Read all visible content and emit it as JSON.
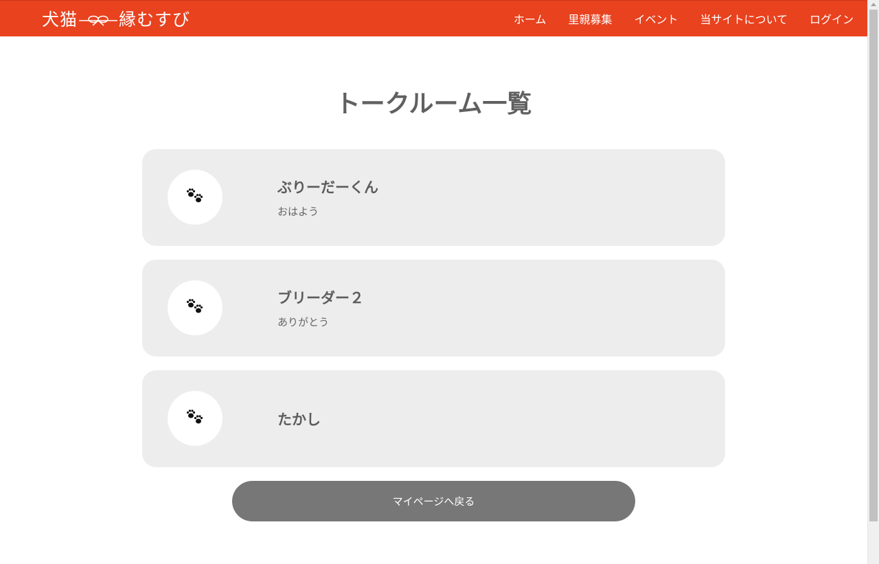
{
  "header": {
    "logo_left": "犬猫",
    "logo_right": "縁むすび",
    "nav": [
      {
        "label": "ホーム"
      },
      {
        "label": "里親募集"
      },
      {
        "label": "イベント"
      },
      {
        "label": "当サイトについて"
      },
      {
        "label": "ログイン"
      }
    ],
    "bg_color": "#e8421f"
  },
  "main": {
    "title": "トークルーム一覧",
    "rooms": [
      {
        "name": "ぶりーだーくん",
        "last_message": "おはよう",
        "icon": "paw-icon"
      },
      {
        "name": "ブリーダー２",
        "last_message": "ありがとう",
        "icon": "paw-icon"
      },
      {
        "name": "たかし",
        "last_message": "",
        "icon": "paw-icon"
      }
    ],
    "back_button_label": "マイページへ戻る"
  },
  "colors": {
    "card_bg": "#ededed",
    "button_bg": "#777777",
    "title_text": "#606060"
  }
}
